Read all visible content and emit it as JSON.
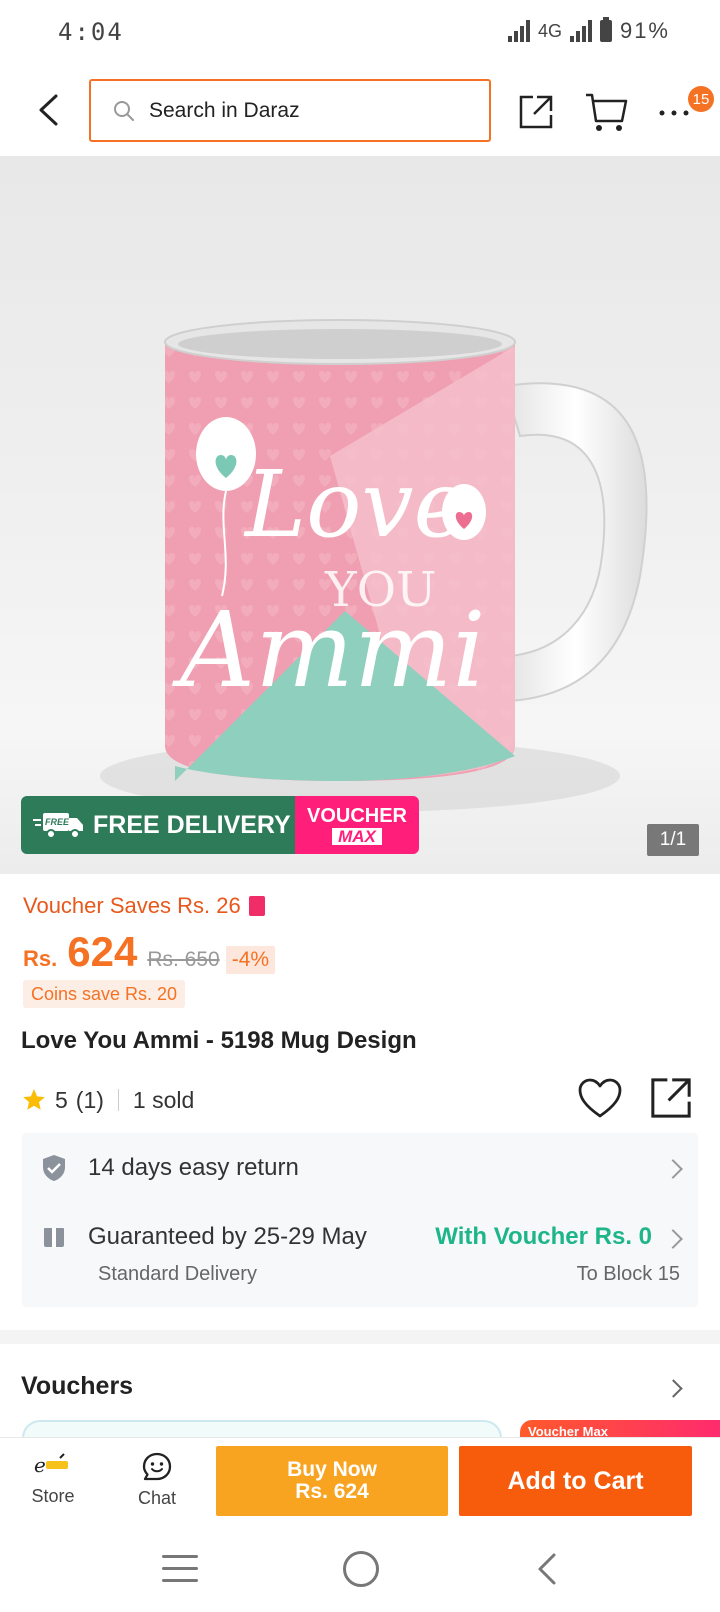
{
  "status_bar": {
    "time": "4:04",
    "network": "4G",
    "battery": "91%"
  },
  "header": {
    "search_placeholder": "Search in Daraz",
    "cart_badge": "15"
  },
  "product_image": {
    "promo_free_delivery": "FREE DELIVERY",
    "promo_free_tag": "FREE",
    "promo_voucher": "VOUCHER",
    "promo_max": "MAX",
    "counter": "1/1",
    "mug_text_love": "Love",
    "mug_text_you": "YOU",
    "mug_text_ammi": "Ammi"
  },
  "product": {
    "voucher_saves": "Voucher Saves Rs. 26",
    "currency": "Rs.",
    "price": "624",
    "original_price": "Rs. 650",
    "discount": "-4%",
    "coins_save": "Coins save Rs. 20",
    "title": "Love You Ammi - 5198 Mug Design",
    "rating": "5",
    "rating_count": "(1)",
    "sold": "1 sold"
  },
  "services": {
    "return": "14 days easy return",
    "guarantee": "Guaranteed by 25-29 May",
    "voucher_shipping": "With Voucher Rs. 0",
    "delivery_type": "Standard Delivery",
    "delivery_to": "To Block 15"
  },
  "vouchers": {
    "title": "Vouchers",
    "peek_label": "Voucher Max"
  },
  "action_bar": {
    "store_label": "Store",
    "chat_label": "Chat",
    "buy_now": "Buy Now",
    "buy_now_price": "Rs. 624",
    "add_to_cart": "Add to Cart"
  },
  "colors": {
    "accent": "#f57224",
    "buy_now": "#f9a421",
    "add_to_cart": "#f75c0c",
    "green": "#1fb58b"
  }
}
